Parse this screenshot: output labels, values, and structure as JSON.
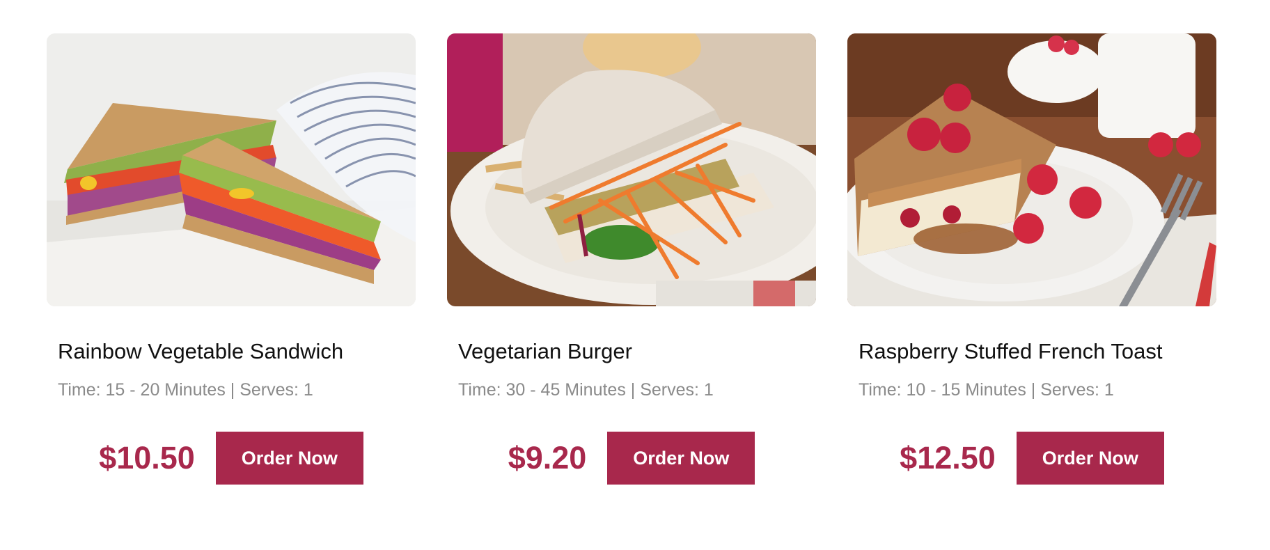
{
  "products": [
    {
      "title": "Rainbow Vegetable Sandwich",
      "meta": "Time: 15 - 20 Minutes | Serves: 1",
      "price": "$10.50",
      "button": "Order Now",
      "image_alt": "Rainbow vegetable sandwich cut in halves on a marble board"
    },
    {
      "title": "Vegetarian Burger",
      "meta": "Time: 30 - 45 Minutes | Serves: 1",
      "price": "$9.20",
      "button": "Order Now",
      "image_alt": "Vegetarian burger with carrots and lettuce on a white plate"
    },
    {
      "title": "Raspberry Stuffed French Toast",
      "meta": "Time: 10 - 15 Minutes | Serves: 1",
      "price": "$12.50",
      "button": "Order Now",
      "image_alt": "Raspberry stuffed french toast with syrup on a white plate"
    }
  ],
  "colors": {
    "accent": "#a8284c",
    "title_text": "#111111",
    "meta_text": "#8a8a8a"
  }
}
